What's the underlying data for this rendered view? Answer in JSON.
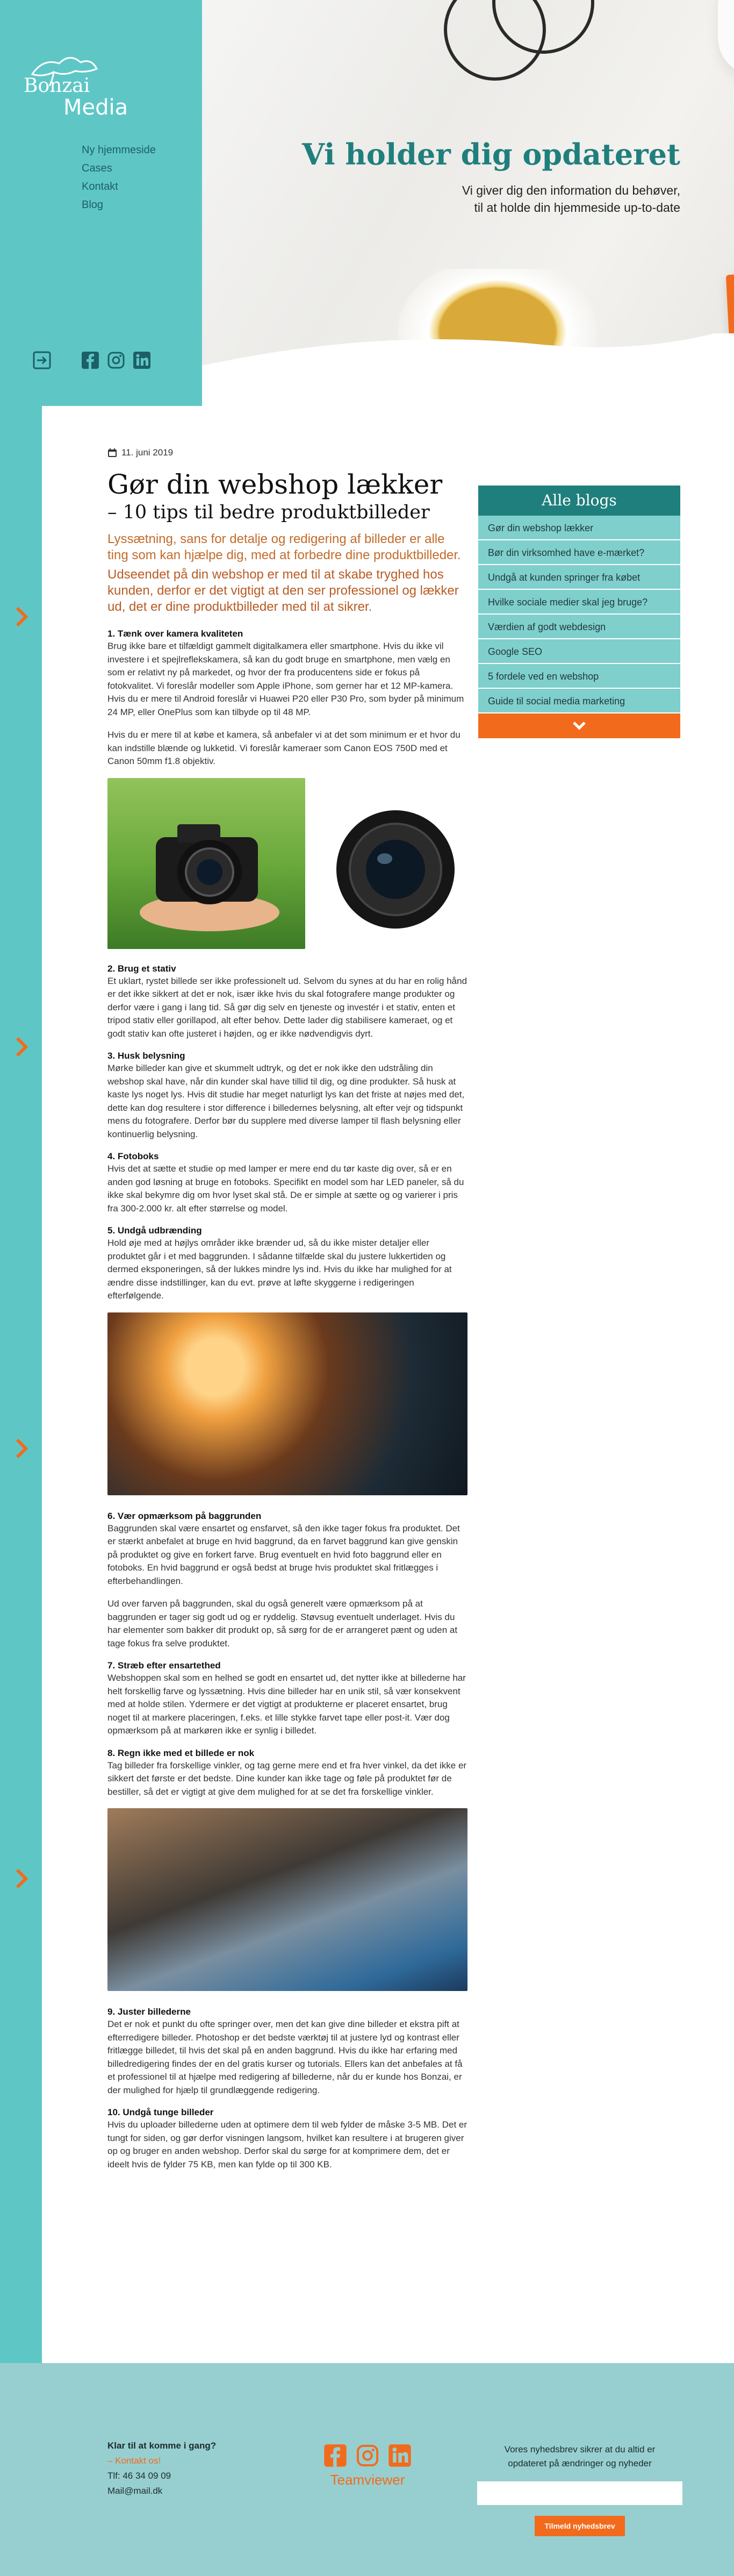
{
  "brand": {
    "line1": "Bonzai",
    "line2": "Media"
  },
  "nav": [
    "Ny hjemmeside",
    "Cases",
    "Kontakt",
    "Blog"
  ],
  "hero": {
    "title": "Vi holder dig opdateret",
    "subtitle_line1": "Vi giver dig den information du behøver,",
    "subtitle_line2": "til at holde din hjemmeside up-to-date"
  },
  "article": {
    "date": "11. juni 2019",
    "title": "Gør din webshop lækker",
    "subtitle": "– 10 tips til bedre produktbilleder",
    "lead1": "Lyssætning, sans for detalje og redigering af billeder er alle ting som kan hjælpe dig, med at forbedre dine produktbilleder.",
    "lead2": "Udseendet på din webshop er med til at skabe tryghed hos kunden, derfor er det vigtigt at den ser professionel og lækker ud, det er dine produktbilleder med til at sikrer.",
    "sections": [
      {
        "heading": "1. Tænk over kamera kvaliteten",
        "body": [
          "Brug ikke bare et tilfældigt gammelt digitalkamera eller smartphone. Hvis du ikke vil investere i et spejlreflekskamera, så kan du godt bruge en smartphone, men vælg en som er relativt ny på markedet, og hvor der fra producentens side er fokus på fotokvalitet. Vi foreslår modeller som Apple iPhone, som gerner har et 12 MP-kamera. Hvis du er mere til Android foreslår vi Huawei P20 eller P30 Pro, som byder på minimum 24 MP, eller OnePlus som kan tilbyde op til 48 MP.",
          "Hvis du er mere til at købe et kamera, så anbefaler vi at det som minimum er et hvor du kan indstille blænde og lukketid. Vi foreslår kameraer som Canon EOS 750D med et Canon 50mm f1.8 objektiv."
        ]
      },
      {
        "heading": "2. Brug et stativ",
        "body": [
          "Et uklart, rystet billede ser ikke professionelt ud. Selvom du synes at du har en rolig hånd er det ikke sikkert at det er nok, især ikke hvis du skal fotografere mange produkter og derfor være i gang i lang tid. Så gør dig selv en tjeneste og investér i et stativ, enten et tripod stativ eller gorillapod, alt efter behov. Dette lader dig stabilisere kameraet, og et godt stativ kan ofte justeret i højden, og er ikke nødvendigvis dyrt."
        ]
      },
      {
        "heading": "3. Husk belysning",
        "body": [
          "Mørke billeder kan give et skummelt udtryk, og det er nok ikke den udstråling din webshop skal have, når din kunder skal have tillid til dig, og dine produkter. Så husk at kaste lys noget lys. Hvis dit studie har meget naturligt lys kan det friste at nøjes med det, dette kan dog resultere i stor difference i billedernes belysning, alt efter vejr og tidspunkt mens du fotografere. Derfor bør du supplere med diverse lamper til flash belysning eller kontinuerlig belysning."
        ]
      },
      {
        "heading": "4. Fotoboks",
        "body": [
          "Hvis det at sætte et studie op med lamper er mere end du tør kaste dig over, så er en anden god løsning at bruge en fotoboks. Specifikt en model som har LED paneler, så du ikke skal bekymre dig om hvor lyset skal stå. De er simple at sætte og og varierer i pris fra 300-2.000 kr. alt efter størrelse og model."
        ]
      },
      {
        "heading": "5. Undgå udbrænding",
        "body": [
          "Hold øje med at højlys områder ikke brænder ud, så du ikke mister detaljer eller produktet går i et med baggrunden. I sådanne tilfælde skal du justere lukkertiden og dermed eksponeringen, så der lukkes mindre lys ind. Hvis du ikke har mulighed for at ændre disse indstillinger, kan du evt. prøve at løfte skyggerne i redigeringen efterfølgende."
        ]
      },
      {
        "heading": "6. Vær opmærksom på baggrunden",
        "body": [
          "Baggrunden skal være ensartet og ensfarvet, så den ikke tager fokus fra produktet. Det er stærkt anbefalet at bruge en hvid baggrund, da en farvet baggrund kan give genskin på produktet og give en forkert farve. Brug eventuelt en hvid foto baggrund eller en fotoboks. En hvid baggrund er også bedst at bruge hvis produktet skal fritlægges i efterbehandlingen.",
          "Ud over farven på baggrunden, skal du også generelt være opmærksom på at baggrunden er tager sig godt ud og er ryddelig. Støvsug eventuelt underlaget. Hvis du har elementer som bakker dit produkt op, så sørg for de er arrangeret pænt og uden at tage fokus fra selve produktet."
        ]
      },
      {
        "heading": "7. Stræb efter ensartethed",
        "body": [
          "Webshoppen skal som en helhed se godt en ensartet ud, det nytter ikke at billederne har helt forskellig farve og lyssætning. Hvis dine billeder har en unik stil, så vær konsekvent med at holde stilen. Ydermere er det vigtigt at produkterne er placeret ensartet, brug noget til at markere placeringen, f.eks. et lille stykke farvet tape eller post-it. Vær dog opmærksom på at markøren ikke er synlig i billedet."
        ]
      },
      {
        "heading": "8. Regn ikke med et billede er nok",
        "body": [
          "Tag billeder fra forskellige vinkler, og tag gerne mere end et fra hver vinkel, da det ikke er sikkert det første er det bedste. Dine kunder kan ikke tage og føle på produktet før de bestiller, så det er vigtigt at give dem mulighed for at se det fra forskellige vinkler."
        ]
      },
      {
        "heading": "9. Juster billederne",
        "body": [
          "Det er nok et punkt du ofte springer over, men det kan give dine billeder et ekstra pift at efterredigere billeder. Photoshop er det bedste værktøj til at justere lyd og kontrast eller fritlægge billedet, til hvis det skal på en anden baggrund. Hvis du ikke har erfaring med billedredigering findes der en del gratis kurser og tutorials. Ellers kan det anbefales at få et professionel til at hjælpe med redigering af billederne, når du er kunde hos Bonzai, er der mulighed for hjælp til grundlæggende redigering."
        ]
      },
      {
        "heading": "10. Undgå tunge billeder",
        "body": [
          "Hvis du uploader billederne uden at optimere dem til web fylder de måske 3-5 MB. Det er tungt for siden, og gør derfor visningen langsom, hvilket kan resultere i at brugeren giver op og bruger en anden webshop. Derfor skal du sørge for at komprimere dem, det er ideelt hvis de fylder 75 KB, men kan fylde op til 300 KB."
        ]
      }
    ]
  },
  "sidebar": {
    "heading": "Alle blogs",
    "items": [
      "Gør din webshop lækker",
      "Bør din virksomhed have e-mærket?",
      "Undgå at kunden springer fra købet",
      "Hvilke sociale medier skal jeg bruge?",
      "Værdien af godt webdesign",
      "Google SEO",
      "5 fordele ved en webshop",
      "Guide til social media marketing"
    ]
  },
  "footer": {
    "question": "Klar til at komme i gang?",
    "contact_link": "– Kontakt os!",
    "phone": "Tlf: 46 34 09 09",
    "email": "Mail@mail.dk",
    "teamviewer": "Teamviewer",
    "newsletter_text_line1": "Vores nyhedsbrev sikrer at du altid er",
    "newsletter_text_line2": "opdateret på ændringer og nyheder",
    "newsletter_button": "Tilmeld nyhedsbrev"
  },
  "colors": {
    "teal": "#5ec7c6",
    "dark_teal": "#1f7f7c",
    "orange": "#f26b1d",
    "footer": "#97cfd0"
  }
}
